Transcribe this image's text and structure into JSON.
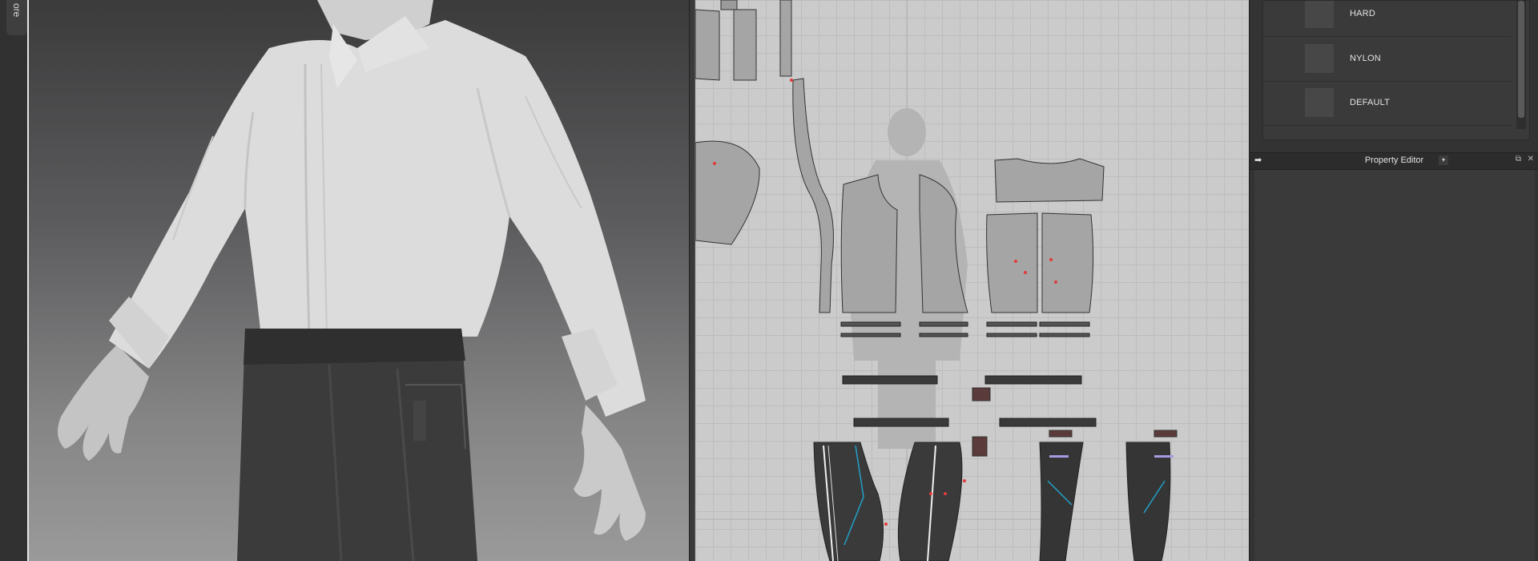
{
  "left_strip": {
    "tab_label": "ore"
  },
  "library": {
    "items": [
      {
        "label": "HARD"
      },
      {
        "label": "NYLON"
      },
      {
        "label": "DEFAULT"
      }
    ]
  },
  "property_editor": {
    "title": "Property Editor",
    "dropdown_glyph": "▾",
    "pin_glyph": "➡",
    "float_glyph": "⧉",
    "close_glyph": "✕"
  },
  "icons": [
    "pin-icon",
    "dropdown-icon",
    "float-window-icon",
    "close-icon",
    "scroll-down-icon"
  ],
  "colors": {
    "pattern_fill": "#a3a3a3",
    "dark_fabric": "#3a3a3a",
    "pin_red": "#e23b3b",
    "seam_cyan": "#23a0c8",
    "panel_bg": "#333333"
  }
}
